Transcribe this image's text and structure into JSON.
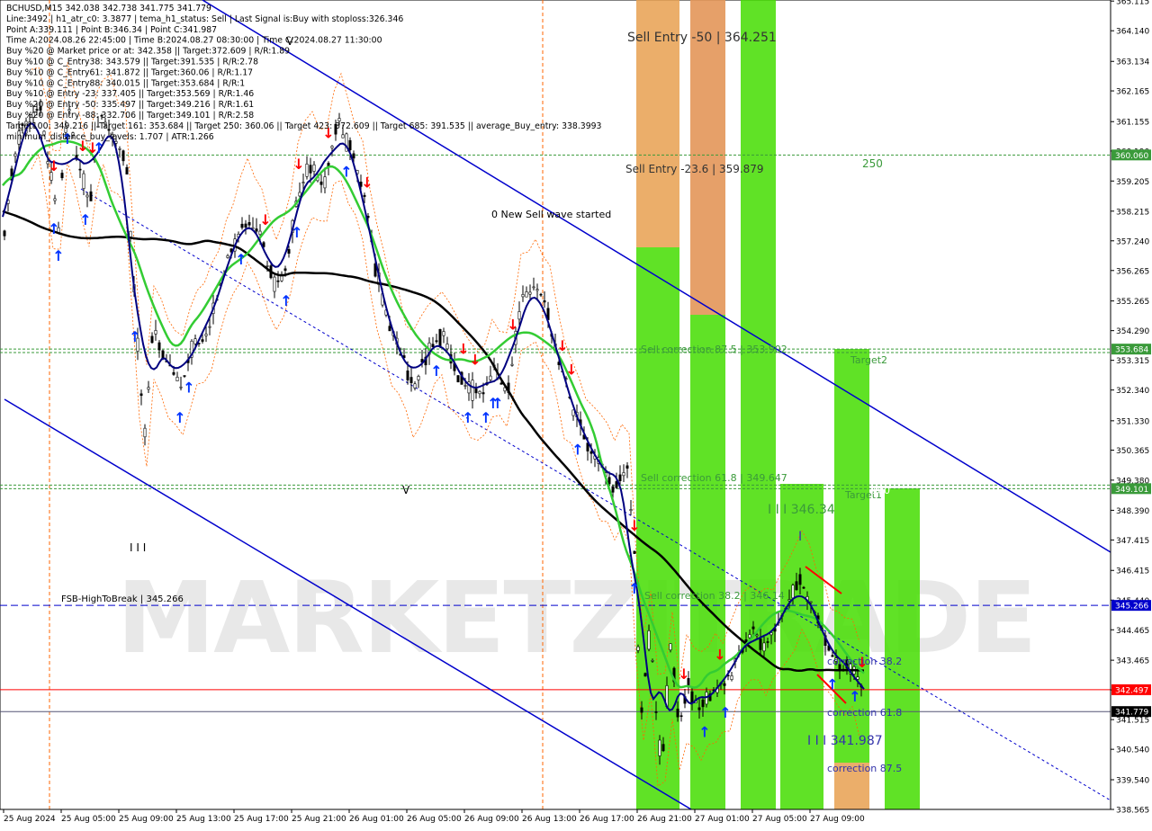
{
  "header": {
    "lines": [
      "BCHUSD,M15  342.038 342.738 341.775 341.779",
      "Line:3492 | h1_atr_c0: 3.3877 | tema_h1_status: Sell | Last Signal is:Buy with stoploss:326.346",
      "Point A:339.111 | Point B:346.34 | Point C:341.987",
      "Time A:2024.08.26 22:45:00 | Time B:2024.08.27 08:30:00 | Time C:2024.08.27 11:30:00",
      "Buy %20 @ Market price or at: 342.358 || Target:372.609 | R/R:1.89",
      "Buy %10 @ C_Entry38: 343.579 || Target:391.535 | R/R:2.78",
      "Buy %10 @ C_Entry61: 341.872 || Target:360.06 | R/R:1.17",
      "Buy %10 @ C_Entry88: 340.015 || Target:353.684 | R/R:1",
      "Buy %10 @ Entry -23: 337.405 || Target:353.569 | R/R:1.46",
      "Buy %20 @ Entry -50: 335.497 || Target:349.216 | R/R:1.61",
      "Buy %20 @ Entry -88: 332.706 || Target:349.101 | R/R:2.58",
      "Target100: 349.216 || Target 161: 353.684 || Target 250: 360.06 || Target 423: 372.609 || Target 685: 391.535 || average_Buy_entry: 338.3993",
      "minimum_distance_buy_levels: 1.707 | ATR:1.266"
    ]
  },
  "watermark": "MARKETZITRADE",
  "colors": {
    "background": "#ffffff",
    "channel": "#0000cc",
    "ema_green": "#33cc33",
    "ma_navy": "#000080",
    "ma_black": "#000000",
    "candle_up": "#000000",
    "candle_down": "#000000",
    "buy_arrow": "#0033ff",
    "sell_arrow": "#ff0000",
    "band_green": "#44dd00",
    "band_orange": "#e8a050",
    "level_green": "#3a9a3a",
    "level_blue": "#0000cc",
    "level_red": "#ff0000",
    "price_line": "#555577"
  },
  "chart_data": {
    "type": "candlestick",
    "symbol": "BCHUSD",
    "timeframe": "M15",
    "ylim": [
      338.565,
      365.15
    ],
    "price_ticks": [
      "365.115",
      "364.140",
      "363.134",
      "362.165",
      "361.155",
      "360.190",
      "359.205",
      "358.215",
      "357.240",
      "356.265",
      "355.265",
      "354.290",
      "353.315",
      "352.340",
      "351.330",
      "350.365",
      "349.380",
      "348.390",
      "347.415",
      "346.415",
      "345.440",
      "344.465",
      "343.465",
      "342.490",
      "341.515",
      "340.540",
      "339.540",
      "338.565"
    ],
    "time_labels": [
      "25 Aug 2024",
      "25 Aug 05:00",
      "25 Aug 09:00",
      "25 Aug 13:00",
      "25 Aug 17:00",
      "25 Aug 21:00",
      "26 Aug 01:00",
      "26 Aug 05:00",
      "26 Aug 09:00",
      "26 Aug 13:00",
      "26 Aug 17:00",
      "26 Aug 21:00",
      "27 Aug 01:00",
      "27 Aug 05:00",
      "27 Aug 09:00"
    ],
    "price_tags": [
      {
        "value": "360.060",
        "bg": "#3a9a3a"
      },
      {
        "value": "353.684",
        "bg": "#3a9a3a"
      },
      {
        "value": "349.101",
        "bg": "#3a9a3a"
      },
      {
        "value": "345.266",
        "bg": "#0000cc"
      },
      {
        "value": "342.497",
        "bg": "#ff0000"
      },
      {
        "value": "341.779",
        "bg": "#000000"
      }
    ],
    "levels": [
      {
        "value": 360.06,
        "style": "green-dashed"
      },
      {
        "value": 353.684,
        "style": "green-dashed"
      },
      {
        "value": 353.569,
        "style": "green-dashed"
      },
      {
        "value": 349.216,
        "style": "green-dashed"
      },
      {
        "value": 349.101,
        "style": "green-dashed"
      },
      {
        "value": 345.266,
        "style": "blue-dashed"
      },
      {
        "value": 342.497,
        "style": "red-solid"
      },
      {
        "value": 341.779,
        "style": "gray-solid"
      }
    ],
    "annotations": [
      "Sell Entry -50 | 364.251",
      "Sell Entry -23.6 | 359.879",
      "250",
      "0 New Sell wave started",
      "Sell correction 87.5 | 353.902",
      "Target2",
      "Sell correction 61.8 | 349.647",
      "Target1",
      "100",
      "I I I  346.34",
      "I",
      "I I I",
      "V",
      "V",
      "FSB-HighToBreak | 345.266",
      "Sell correction 38.2 | 346.14",
      "correction 38.2",
      "correction 61.8",
      "I I I  341.987",
      "correction 87.5"
    ]
  }
}
